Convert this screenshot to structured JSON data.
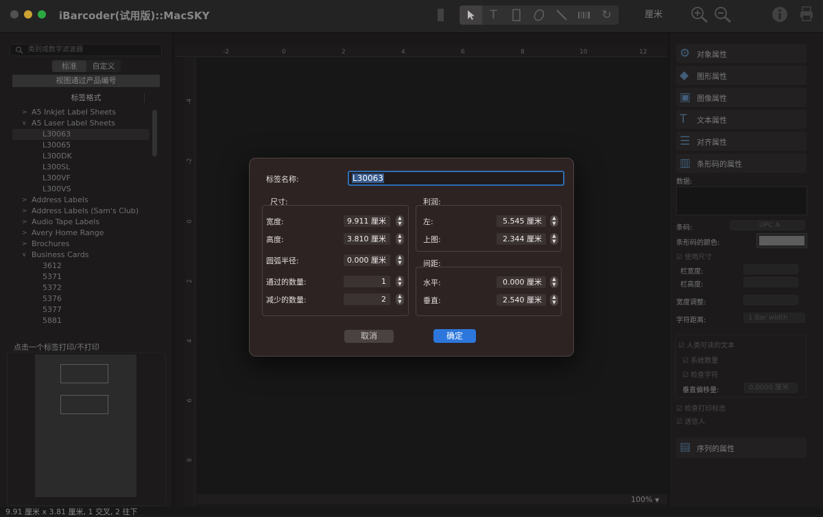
{
  "app": {
    "title": "iBarcoder(试用版)::MacSKY",
    "unit": "厘米"
  },
  "toolbar": {
    "tools": [
      "select-arrow",
      "text-tool",
      "rectangle-tool",
      "ellipse-tool",
      "line-tool",
      "barcode-tool",
      "rotate-tool"
    ],
    "icons": [
      "zoom-in-icon",
      "zoom-out-icon",
      "info-icon",
      "print-icon"
    ]
  },
  "sidebar": {
    "search_placeholder": "类别或数字滤波器",
    "tabs": [
      "标准",
      "自定义"
    ],
    "view_button": "视图通过产品编号",
    "list_header": "标签格式",
    "tree": [
      {
        "label": "A5 Inkjet Label Sheets",
        "level": 0,
        "expanded": false
      },
      {
        "label": "A5 Laser Label Sheets",
        "level": 0,
        "expanded": true
      },
      {
        "label": "L30063",
        "level": 1,
        "selected": true
      },
      {
        "label": "L30065",
        "level": 1
      },
      {
        "label": "L300DK",
        "level": 1
      },
      {
        "label": "L300SL",
        "level": 1
      },
      {
        "label": "L300VF",
        "level": 1
      },
      {
        "label": "L300VS",
        "level": 1
      },
      {
        "label": "Address Labels",
        "level": 0,
        "expanded": false
      },
      {
        "label": "Address Labels (Sam's Club)",
        "level": 0,
        "expanded": false
      },
      {
        "label": "Audio Tape Labels",
        "level": 0,
        "expanded": false
      },
      {
        "label": "Avery Home Range",
        "level": 0,
        "expanded": false
      },
      {
        "label": "Brochures",
        "level": 0,
        "expanded": false
      },
      {
        "label": "Business Cards",
        "level": 0,
        "expanded": true
      },
      {
        "label": "3612",
        "level": 1
      },
      {
        "label": "5371",
        "level": 1
      },
      {
        "label": "5372",
        "level": 1
      },
      {
        "label": "5376",
        "level": 1
      },
      {
        "label": "5377",
        "level": 1
      },
      {
        "label": "5881",
        "level": 1
      }
    ],
    "print_hint": "点击一个标签打印/不打印",
    "status": "9.91 厘米 x 3.81 厘米, 1 交叉, 2 往下"
  },
  "canvas": {
    "hruler": [
      "-2",
      "0",
      "2",
      "4",
      "6",
      "8",
      "10",
      "12"
    ],
    "vruler": [
      "-4",
      "-2",
      "0",
      "2",
      "4",
      "6",
      "8"
    ],
    "zoom": "100%"
  },
  "inspector": {
    "sections": [
      {
        "label": "对象属性",
        "icon": "object-properties-icon"
      },
      {
        "label": "图形属性",
        "icon": "graphics-properties-icon"
      },
      {
        "label": "图像属性",
        "icon": "image-properties-icon"
      },
      {
        "label": "文本属性",
        "icon": "text-properties-icon"
      },
      {
        "label": "对齐属性",
        "icon": "align-properties-icon"
      },
      {
        "label": "条形码的属性",
        "icon": "barcode-properties-icon"
      }
    ],
    "data_label": "数据:",
    "symbology_label": "条码:",
    "symbology_value": "UPC A",
    "color_label": "条形码的颜色:",
    "use_size_label": "使用尺寸",
    "bar_width_label": "栏宽度:",
    "bar_height_label": "栏高度:",
    "width_adjust_label": "宽度调整:",
    "char_spacing_label": "字符距离:",
    "char_spacing_value": "1 Bar width",
    "human_readable_label": "人类可读的文本",
    "system_digit_label": "系统数量",
    "check_digit_label": "检查字符",
    "vertical_offset_label": "垂直偏移量:",
    "vertical_offset_value": "0.0000 厘米",
    "print_marks_label": "检查打印标志",
    "sender_label": "送信人",
    "sequence_label": "序列的属性",
    "sequence_icon": "sequence-properties-icon"
  },
  "dialog": {
    "name_label": "标签名称:",
    "name_value": "L30063",
    "size_group": "尺寸:",
    "margin_group": "利润:",
    "spacing_group": "间距:",
    "width_label": "宽度:",
    "width_value": "9.911 厘米",
    "height_label": "高度:",
    "height_value": "3.810 厘米",
    "radius_label": "圆弧半径:",
    "radius_value": "0.000 厘米",
    "across_label": "通过的数量:",
    "across_value": "1",
    "down_label": "减少的数量:",
    "down_value": "2",
    "left_label": "左:",
    "left_value": "5.545 厘米",
    "top_label": "上图:",
    "top_value": "2.344 厘米",
    "hspace_label": "水平:",
    "hspace_value": "0.000 厘米",
    "vspace_label": "垂直:",
    "vspace_value": "2.540 厘米",
    "cancel": "取消",
    "ok": "确定"
  }
}
